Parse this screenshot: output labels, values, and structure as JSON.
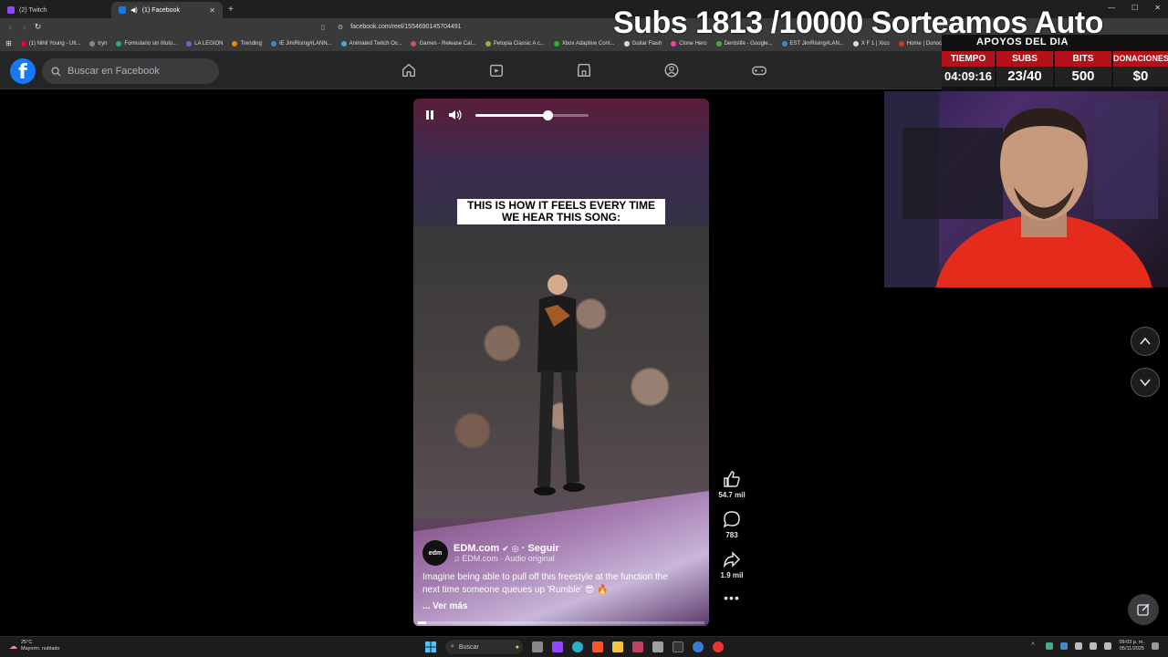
{
  "browser": {
    "tabs": [
      {
        "title": "(2) Twitch",
        "active": false,
        "color": "#9146ff"
      },
      {
        "title": "(1) Facebook",
        "active": true,
        "color": "#1877f2"
      }
    ],
    "url": "facebook.com/reel/1554690145704491",
    "bookmarks": [
      {
        "label": "(1) Nihil Young - Ult...",
        "color": "#e03"
      },
      {
        "label": "tryn",
        "color": "#888"
      },
      {
        "label": "Formulario sin título...",
        "color": "#2a8"
      },
      {
        "label": "LA LEGION",
        "color": "#66c"
      },
      {
        "label": "Trending",
        "color": "#e80"
      },
      {
        "label": "IE JimRising#LANN...",
        "color": "#48c"
      },
      {
        "label": "Animated Twitch Ov...",
        "color": "#4ac"
      },
      {
        "label": "Games - Release Cal...",
        "color": "#c55"
      },
      {
        "label": "Petopia Classic A c...",
        "color": "#aa4"
      },
      {
        "label": "Xbox Adaptive Cont...",
        "color": "#3a3"
      },
      {
        "label": "Guitar Flash",
        "color": "#ddd"
      },
      {
        "label": "Clone Hero",
        "color": "#e4a"
      },
      {
        "label": "Dentslife - Google...",
        "color": "#4a4"
      },
      {
        "label": "EST JimRising#LAN...",
        "color": "#48c"
      },
      {
        "label": "X F 1 | Xico",
        "color": "#ddd"
      },
      {
        "label": "Home | Donoclip",
        "color": "#c33"
      }
    ]
  },
  "facebook": {
    "search_placeholder": "Buscar en Facebook",
    "nav_icons": [
      "home-icon",
      "video-icon",
      "marketplace-icon",
      "groups-icon",
      "gaming-icon"
    ]
  },
  "overlay": {
    "title": "Subs 1813 /10000 Sorteamos Auto",
    "stats_heading": "APOYOS DEL DIA",
    "stats": [
      {
        "label": "TIEMPO",
        "value": "04:09:16"
      },
      {
        "label": "SUBS",
        "value": "23/40"
      },
      {
        "label": "BITS",
        "value": "500"
      },
      {
        "label": "DONACIONES",
        "value": "$0"
      }
    ]
  },
  "reel": {
    "caption_line1": "THIS IS HOW IT FEELS EVERY TIME",
    "caption_line2": "WE HEAR THIS SONG:",
    "volume": 0.64,
    "progress": 0.03,
    "avatar_text": "edm",
    "author": "EDM.com",
    "follow": "Seguir",
    "audio": "EDM.com · Audio original",
    "description_line1": "Imagine being able to pull off this freestyle at the function the",
    "description_line2": "next time someone queues up 'Rumble' 😎 🔥",
    "see_more": "... Ver más"
  },
  "actions": {
    "likes": "54.7 mil",
    "comments": "783",
    "shares": "1.9 mil"
  },
  "taskbar": {
    "temperature": "25°C",
    "weather": "Mayorm. nublado",
    "search": "Buscar",
    "time": "09:03 p. m.",
    "date": "05/11/2025"
  }
}
